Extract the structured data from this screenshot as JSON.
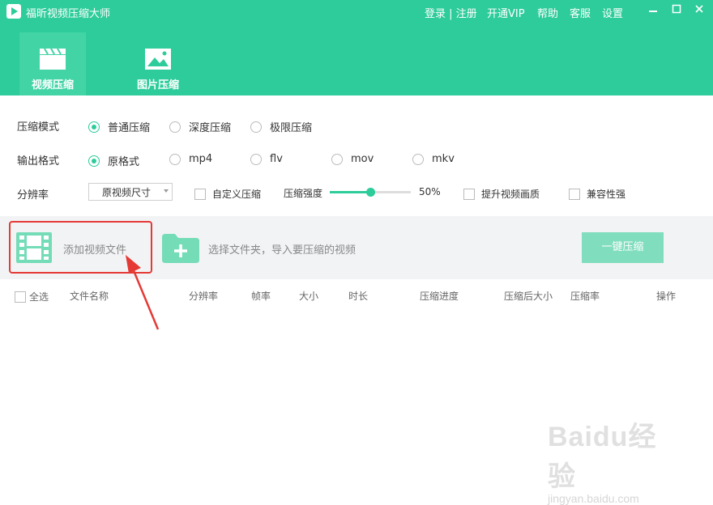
{
  "app": {
    "title": "福昕视频压缩大师"
  },
  "topnav": {
    "login": "登录 | 注册",
    "vip": "开通VIP",
    "help": "帮助",
    "service": "客服",
    "settings": "设置"
  },
  "window_controls": {
    "minimize": "▭",
    "maximize": "□",
    "close": "✕"
  },
  "tabs": [
    {
      "label": "视频压缩",
      "icon": "clapperboard-icon",
      "active": true
    },
    {
      "label": "图片压缩",
      "icon": "image-icon",
      "active": false
    }
  ],
  "compress_mode": {
    "label": "压缩模式",
    "options": [
      "普通压缩",
      "深度压缩",
      "极限压缩"
    ],
    "selected": "普通压缩"
  },
  "output_format": {
    "label": "输出格式",
    "options": [
      "原格式",
      "mp4",
      "flv",
      "mov",
      "mkv"
    ],
    "selected": "原格式"
  },
  "resolution": {
    "label": "分辨率",
    "select_value": "原视频尺寸",
    "custom_compress": "自定义压缩",
    "strength_label": "压缩强度",
    "strength_value": "50%",
    "strength_fraction": 0.5,
    "enhance_quality": "提升视频画质",
    "compat": "兼容性强"
  },
  "actions": {
    "add_video": "添加视频文件",
    "select_folder": "选择文件夹，导入要压缩的视频",
    "compress_all": "一键压缩"
  },
  "table": {
    "select_all": "全选",
    "columns": [
      "文件名称",
      "分辨率",
      "帧率",
      "大小",
      "时长",
      "压缩进度",
      "压缩后大小",
      "压缩率",
      "操作"
    ]
  },
  "watermark": {
    "brand": "Baidu经验",
    "url": "jingyan.baidu.com"
  },
  "colors": {
    "accent": "#2dcc9a",
    "highlight_box": "#e53935",
    "arrow": "#e53935"
  }
}
